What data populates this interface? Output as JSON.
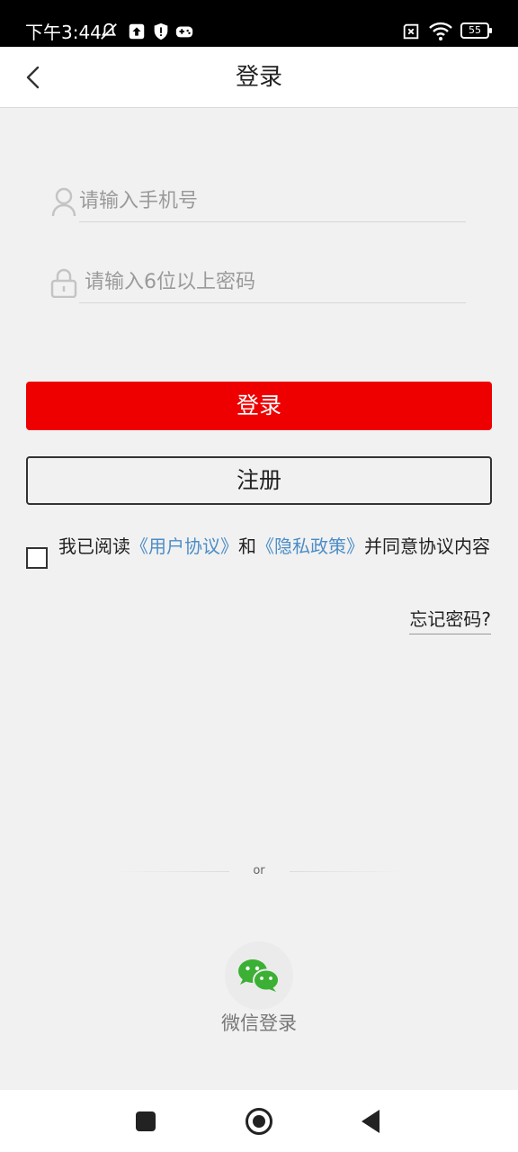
{
  "status_bar": {
    "time": "下午3:44",
    "battery": "55"
  },
  "header": {
    "title": "登录"
  },
  "form": {
    "phone_placeholder": "请输入手机号",
    "password_placeholder": "请输入6位以上密码"
  },
  "buttons": {
    "login_label": "登录",
    "register_label": "注册"
  },
  "agreement": {
    "prefix": "我已阅读",
    "user_agreement": "《用户协议》",
    "and": "和",
    "privacy_policy": "《隐私政策》",
    "suffix": "并同意协议内容",
    "checked": false
  },
  "forgot_password": "忘记密码?",
  "divider_text": "or",
  "wechat_login": "微信登录",
  "colors": {
    "primary": "#ee0000",
    "link": "#4c8dc7",
    "wechat": "#3bb034"
  }
}
